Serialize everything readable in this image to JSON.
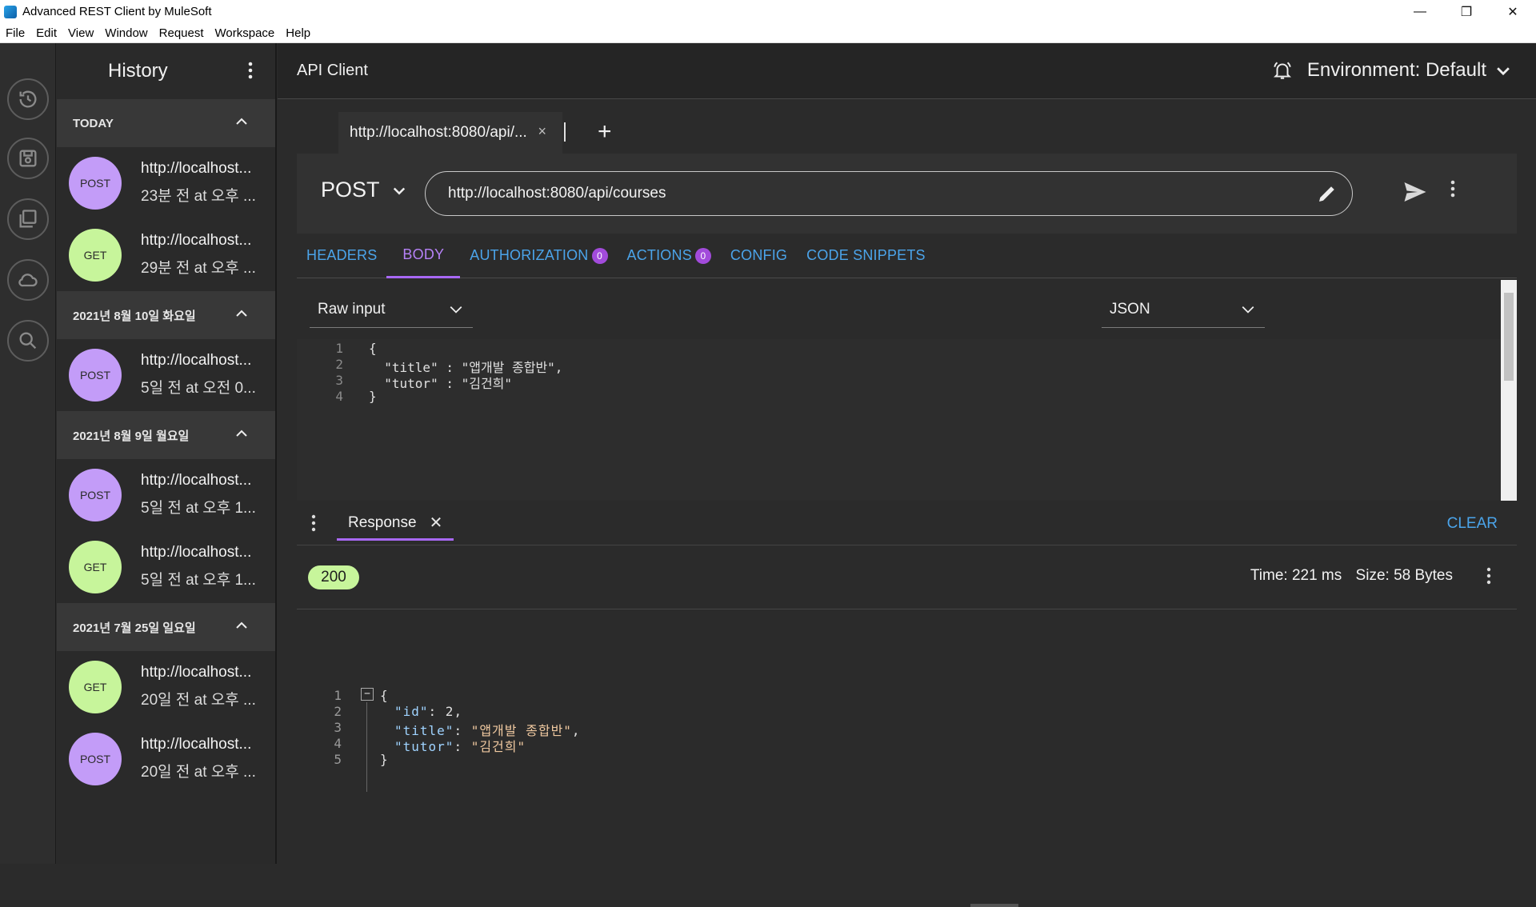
{
  "window": {
    "title": "Advanced REST Client by MuleSoft"
  },
  "menu": [
    "File",
    "Edit",
    "View",
    "Window",
    "Request",
    "Workspace",
    "Help"
  ],
  "rail": [
    {
      "name": "history-icon"
    },
    {
      "name": "save-icon"
    },
    {
      "name": "projects-icon"
    },
    {
      "name": "cloud-icon"
    },
    {
      "name": "search-icon"
    }
  ],
  "history": {
    "title": "History",
    "groups": [
      {
        "label": "TODAY",
        "items": [
          {
            "method": "POST",
            "url": "http://localhost...",
            "time": "23분 전 at 오후 ..."
          },
          {
            "method": "GET",
            "url": "http://localhost...",
            "time": "29분 전 at 오후 ..."
          }
        ]
      },
      {
        "label": "2021년 8월 10일 화요일",
        "items": [
          {
            "method": "POST",
            "url": "http://localhost...",
            "time": "5일 전 at 오전 0..."
          }
        ]
      },
      {
        "label": "2021년 8월 9일 월요일",
        "items": [
          {
            "method": "POST",
            "url": "http://localhost...",
            "time": "5일 전 at 오후 1..."
          },
          {
            "method": "GET",
            "url": "http://localhost...",
            "time": "5일 전 at 오후 1..."
          }
        ]
      },
      {
        "label": "2021년 7월 25일 일요일",
        "items": [
          {
            "method": "GET",
            "url": "http://localhost...",
            "time": "20일 전 at 오후 ..."
          },
          {
            "method": "POST",
            "url": "http://localhost...",
            "time": "20일 전 at 오후 ..."
          }
        ]
      }
    ]
  },
  "topbar": {
    "title": "API Client",
    "environment": "Environment: Default"
  },
  "tab": {
    "label": "http://localhost:8080/api/...",
    "close": "×",
    "add": "+"
  },
  "request": {
    "method": "POST",
    "url": "http://localhost:8080/api/courses"
  },
  "subtabs": {
    "headers": "HEADERS",
    "body": "BODY",
    "authorization": "AUTHORIZATION",
    "authorization_count": "0",
    "actions": "ACTIONS",
    "actions_count": "0",
    "config": "CONFIG",
    "code_snippets": "CODE SNIPPETS"
  },
  "body": {
    "editor_type": "Raw input",
    "content_type": "JSON",
    "lines": [
      "1",
      "2",
      "3",
      "4"
    ],
    "code": [
      "{",
      "  \"title\" : \"앱개발 종합반\",",
      "  \"tutor\" : \"김건희\"",
      "}"
    ]
  },
  "response": {
    "tab_label": "Response",
    "clear": "CLEAR",
    "status": "200",
    "time": "Time: 221 ms",
    "size": "Size: 58 Bytes",
    "lines": [
      "1",
      "2",
      "3",
      "4",
      "5"
    ],
    "json": {
      "id_key": "\"id\"",
      "id_val": "2",
      "title_key": "\"title\"",
      "title_val": "\"앱개발 종합반\"",
      "tutor_key": "\"tutor\"",
      "tutor_val": "\"김건희\""
    }
  },
  "colors": {
    "post_badge": "#c39cf8",
    "get_badge": "#c7f59b",
    "link_blue": "#4ba4ea",
    "active_purple": "#a868f5",
    "status_ok": "#c7f59b"
  }
}
